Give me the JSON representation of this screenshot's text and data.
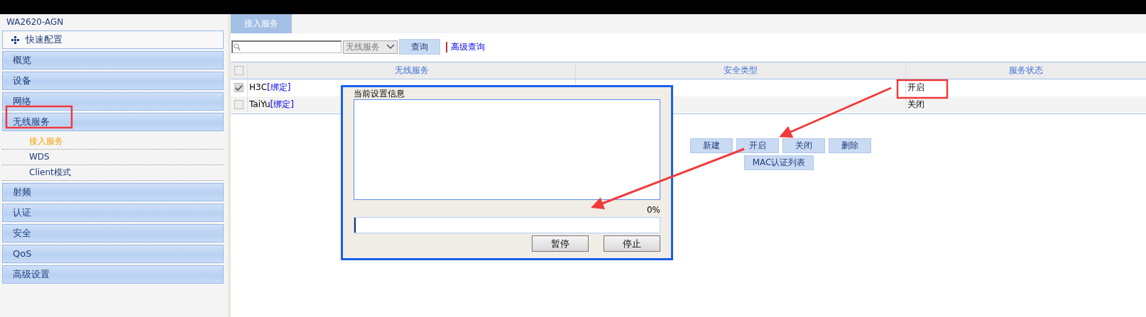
{
  "device_name": "WA2620-AGN",
  "sidebar": {
    "quick_config": {
      "label": "快速配置"
    },
    "items": [
      {
        "label": "概览"
      },
      {
        "label": "设备"
      },
      {
        "label": "网络"
      },
      {
        "label": "无线服务",
        "children": [
          {
            "label": "接入服务",
            "selected": true
          },
          {
            "label": "WDS",
            "selected": false
          },
          {
            "label": "Client模式",
            "selected": false
          }
        ]
      },
      {
        "label": "射频"
      },
      {
        "label": "认证"
      },
      {
        "label": "安全"
      },
      {
        "label": "QoS"
      },
      {
        "label": "高级设置"
      }
    ]
  },
  "tabs": [
    {
      "label": "接入服务",
      "selected": true
    }
  ],
  "search": {
    "filter": "无线服务",
    "button": "查询",
    "advanced_link": "高级查询"
  },
  "table": {
    "header_checked": false,
    "columns": [
      "无线服务",
      "安全类型",
      "服务状态"
    ],
    "rows": [
      {
        "checked": true,
        "name": "H3C",
        "link": "[绑定]",
        "status": "开启"
      },
      {
        "checked": false,
        "name": "TaiYu",
        "link": "[绑定]",
        "status": "关闭"
      }
    ]
  },
  "actions": [
    "新建",
    "开启",
    "关闭",
    "删除",
    "MAC认证列表"
  ],
  "dialog": {
    "title": "当前设置信息",
    "percent": "0%",
    "level": 0,
    "buttons": [
      "暂停",
      "停止"
    ]
  }
}
